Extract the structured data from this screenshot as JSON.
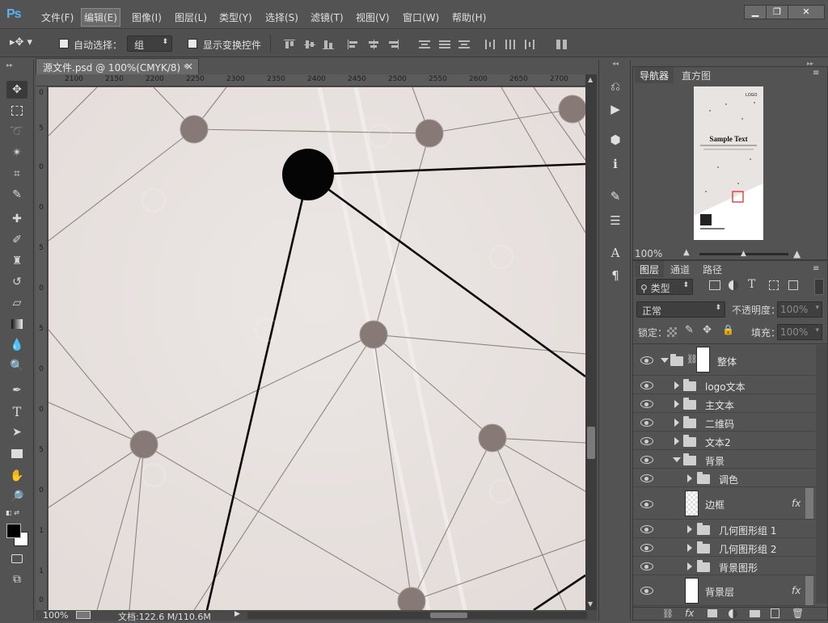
{
  "app": {
    "logo": "Ps"
  },
  "menu": [
    "文件(F)",
    "编辑(E)",
    "图像(I)",
    "图层(L)",
    "类型(Y)",
    "选择(S)",
    "滤镜(T)",
    "视图(V)",
    "窗口(W)",
    "帮助(H)"
  ],
  "active_menu_index": 1,
  "window_controls": {
    "minimize": "▁",
    "restore": "❐",
    "close": "✕"
  },
  "options": {
    "auto_select_label": "自动选择：",
    "auto_select_value": "组",
    "show_transform_label": "显示变换控件"
  },
  "document": {
    "tab_title": "源文件.psd @ 100%(CMYK/8) *",
    "tab_close": "×",
    "ruler_h": [
      "2100",
      "2150",
      "2200",
      "2250",
      "2300",
      "2350",
      "2400",
      "2450",
      "2500",
      "2550",
      "2600",
      "2650",
      "2700"
    ],
    "ruler_v": [
      "0",
      "5",
      "0",
      "0",
      "5",
      "0",
      "5",
      "0",
      "0",
      "5",
      "0",
      "1",
      "1",
      "0"
    ]
  },
  "status": {
    "zoom": "100%",
    "doc_info": "文档:122.6 M/110.6M"
  },
  "navigator": {
    "tabs": [
      "导航器",
      "直方图"
    ],
    "zoom": "100%",
    "thumb_logo": "LOGO",
    "thumb_title": "Sample Text"
  },
  "layers_panel": {
    "tabs": [
      "图层",
      "通道",
      "路径"
    ],
    "filter_label": "类型",
    "blend_mode": "正常",
    "opacity_label": "不透明度：",
    "opacity_value": "100%",
    "lock_label": "锁定：",
    "fill_label": "填充：",
    "fill_value": "100%",
    "fx_label": "fx",
    "layers": [
      {
        "name": "整体",
        "type": "group",
        "expanded": true,
        "level": 0
      },
      {
        "name": "logo文本",
        "type": "group",
        "level": 1
      },
      {
        "name": "主文本",
        "type": "group",
        "level": 1
      },
      {
        "name": "二维码",
        "type": "group",
        "level": 1
      },
      {
        "name": "文本2",
        "type": "group",
        "level": 1
      },
      {
        "name": "背景",
        "type": "group",
        "expanded": true,
        "level": 1
      },
      {
        "name": "调色",
        "type": "group",
        "level": 2
      },
      {
        "name": "边框",
        "type": "layer",
        "fx": true,
        "level": 2
      },
      {
        "name": "几何图形组 1",
        "type": "group",
        "level": 2
      },
      {
        "name": "几何图形组 2",
        "type": "group",
        "level": 2
      },
      {
        "name": "背景图形",
        "type": "group",
        "level": 2
      },
      {
        "name": "背景层",
        "type": "layer",
        "fx": true,
        "level": 2
      }
    ]
  },
  "tool_icons": [
    "move-tool-icon",
    "marquee-tool-icon",
    "lasso-tool-icon",
    "magic-wand-tool-icon",
    "crop-tool-icon",
    "eyedropper-tool-icon",
    "healing-brush-tool-icon",
    "brush-tool-icon",
    "clone-stamp-tool-icon",
    "history-brush-tool-icon",
    "eraser-tool-icon",
    "gradient-tool-icon",
    "blur-tool-icon",
    "dodge-tool-icon",
    "pen-tool-icon",
    "type-tool-icon",
    "path-selection-tool-icon",
    "rectangle-tool-icon",
    "hand-tool-icon",
    "zoom-tool-icon"
  ],
  "colors": {
    "foreground": "#000000",
    "background": "#ffffff",
    "canvas_bg": "#eae4e2",
    "node": "#877a76"
  }
}
